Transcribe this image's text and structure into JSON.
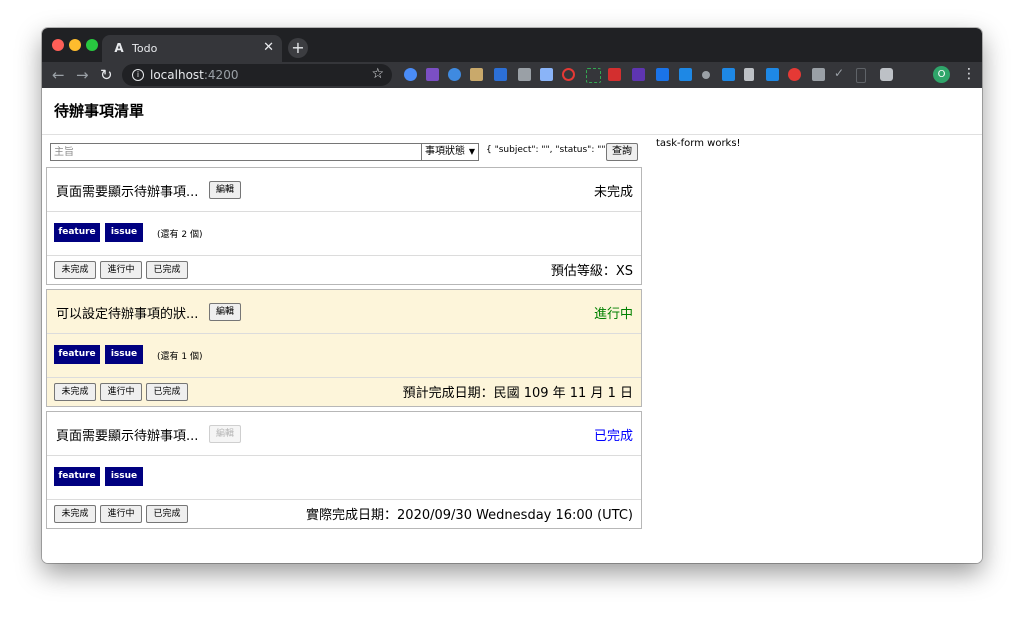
{
  "browser": {
    "tab_title": "Todo",
    "tab_favicon": "A",
    "url_host": "localhost",
    "url_port": ":4200",
    "profile_initial": "O"
  },
  "app": {
    "title": "待辦事項清單",
    "right_panel_text": "task-form works!"
  },
  "query": {
    "subject_placeholder": "主旨",
    "status_selected": "事項狀態",
    "echo": "{ \"subject\": \"\", \"status\": \"\" }",
    "query_button": "查詢"
  },
  "status_buttons": [
    "未完成",
    "進行中",
    "已完成"
  ],
  "edit_label": "編輯",
  "status_colors": {
    "todo": "#000000",
    "in_progress": "#008000",
    "done": "#0000ff"
  },
  "tasks": [
    {
      "subject": "頁面需要顯示待辦事項...",
      "status": "未完成",
      "tags": [
        "feature",
        "issue"
      ],
      "more": "(還有 2 個)",
      "footer_text": "預估等級：XS"
    },
    {
      "subject": "可以設定待辦事項的狀...",
      "status": "進行中",
      "tags": [
        "feature",
        "issue"
      ],
      "more": "(還有 1 個)",
      "footer_text": "預計完成日期：民國 109 年 11 月 1 日"
    },
    {
      "subject": "頁面需要顯示待辦事項...",
      "status": "已完成",
      "tags": [
        "feature",
        "issue"
      ],
      "more": "",
      "footer_text": "實際完成日期：2020/09/30 Wednesday 16:00 (UTC)"
    }
  ]
}
